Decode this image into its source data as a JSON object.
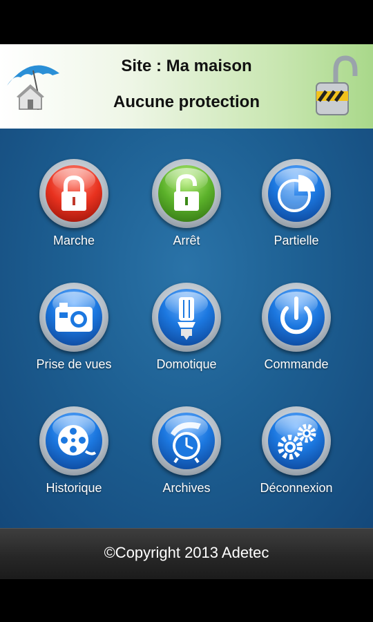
{
  "header": {
    "site_title": "Site : Ma maison",
    "protection_status": "Aucune protection",
    "logo_icon": "house-umbrella-icon",
    "status_icon": "open-padlock-icon"
  },
  "menu": {
    "items": [
      {
        "label": "Marche",
        "icon": "locked-padlock-icon",
        "color": "#e8321f"
      },
      {
        "label": "Arrêt",
        "icon": "unlocked-padlock-icon",
        "color": "#5bb12a"
      },
      {
        "label": "Partielle",
        "icon": "pie-chart-icon",
        "color": "#1c78e0"
      },
      {
        "label": "Prise de vues",
        "icon": "camera-icon",
        "color": "#1c78e0"
      },
      {
        "label": "Domotique",
        "icon": "light-bulb-icon",
        "color": "#1c78e0"
      },
      {
        "label": "Commande",
        "icon": "power-icon",
        "color": "#1c78e0"
      },
      {
        "label": "Historique",
        "icon": "film-reel-icon",
        "color": "#1c78e0"
      },
      {
        "label": "Archives",
        "icon": "stopwatch-icon",
        "color": "#1c78e0"
      },
      {
        "label": "Déconnexion",
        "icon": "gears-icon",
        "color": "#1c78e0"
      }
    ]
  },
  "footer": {
    "copyright": "©Copyright 2013 Adetec"
  }
}
